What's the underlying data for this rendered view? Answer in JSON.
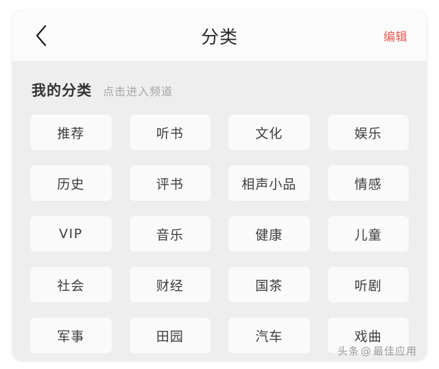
{
  "nav": {
    "back_icon": "chevron-left-icon",
    "title": "分类",
    "edit_label": "编辑",
    "edit_color": "#ec5a52"
  },
  "section": {
    "title": "我的分类",
    "hint": "点击进入频道"
  },
  "grid": {
    "columns": 4,
    "items": [
      {
        "label": "推荐"
      },
      {
        "label": "听书"
      },
      {
        "label": "文化"
      },
      {
        "label": "娱乐"
      },
      {
        "label": "历史"
      },
      {
        "label": "评书"
      },
      {
        "label": "相声小品"
      },
      {
        "label": "情感"
      },
      {
        "label": "VIP"
      },
      {
        "label": "音乐"
      },
      {
        "label": "健康"
      },
      {
        "label": "儿童"
      },
      {
        "label": "社会"
      },
      {
        "label": "财经"
      },
      {
        "label": "国茶"
      },
      {
        "label": "听剧"
      },
      {
        "label": "军事"
      },
      {
        "label": "田园"
      },
      {
        "label": "汽车"
      },
      {
        "label": "戏曲"
      }
    ]
  },
  "watermark": {
    "source": "头条",
    "at": "@",
    "account": "最佳应用"
  },
  "colors": {
    "card_background": "#eeeeee",
    "nav_background": "#fbfbfb",
    "tile_background": "#fafafa",
    "accent_red": "#ec5a52",
    "text_primary": "#333333",
    "text_muted": "#a6a6a6"
  }
}
